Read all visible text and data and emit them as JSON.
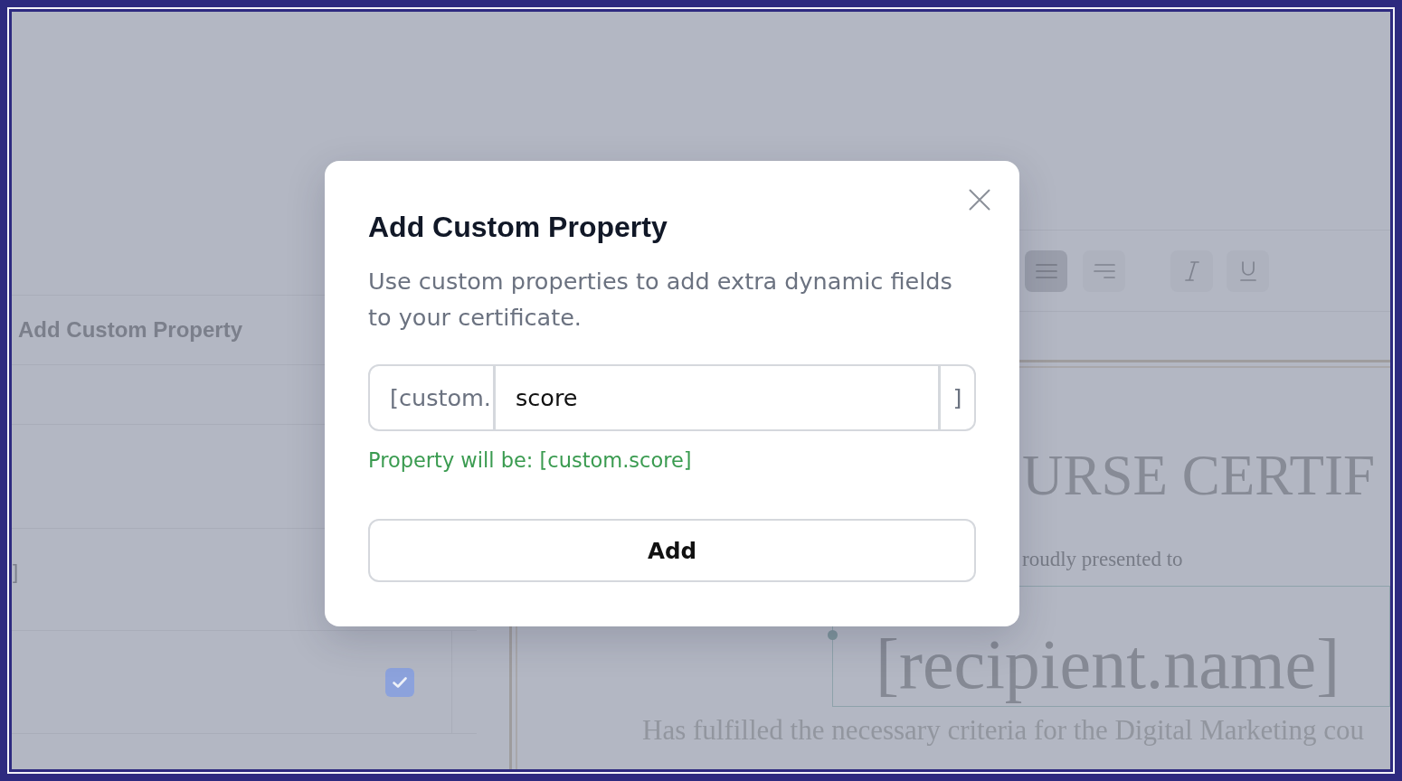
{
  "app": {
    "properties_panel": {
      "items": [
        {
          "kind": "action",
          "label": "Add Custom Property"
        },
        {
          "kind": "text",
          "text": "]"
        },
        {
          "kind": "checkbox",
          "checked": true
        }
      ]
    },
    "toolbar": {
      "alignment_buttons": [
        {
          "selected": true
        },
        {
          "selected": false
        }
      ],
      "style_buttons": [
        {
          "on": false
        },
        {
          "on": false
        }
      ]
    },
    "certificate": {
      "title": "URSE CERTIF",
      "presented_to": "roudly presented to",
      "recipient": {
        "text": "[recipient.name]",
        "selected": true
      },
      "description": "Has fulfilled the necessary criteria for the Digital Marketing cou"
    }
  },
  "dialog": {
    "title": "Add Custom Property",
    "description": "Use custom properties to add extra dynamic fields to your certificate.",
    "property_input": {
      "prefix": "[custom.",
      "value": "score",
      "suffix": "]"
    },
    "preview": "Property will be: [custom.score]",
    "add_button": "Add"
  }
}
